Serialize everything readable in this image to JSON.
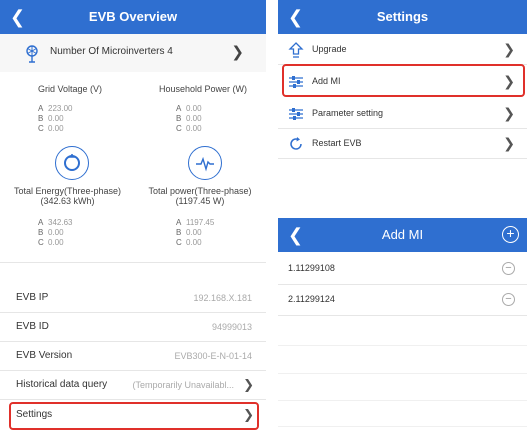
{
  "left": {
    "title": "EVB Overview",
    "microinverters_label": "Number Of Microinverters 4",
    "grid_voltage": {
      "title": "Grid Voltage  (V)",
      "phases": [
        {
          "k": "A",
          "v": "223.00"
        },
        {
          "k": "B",
          "v": "0.00"
        },
        {
          "k": "C",
          "v": "0.00"
        }
      ]
    },
    "household_power": {
      "title": "Household Power  (W)",
      "phases": [
        {
          "k": "A",
          "v": "0.00"
        },
        {
          "k": "B",
          "v": "0.00"
        },
        {
          "k": "C",
          "v": "0.00"
        }
      ]
    },
    "total_energy": {
      "title": "Total Energy(Three-phase)",
      "subtitle": "(342.63 kWh)",
      "phases": [
        {
          "k": "A",
          "v": "342.63"
        },
        {
          "k": "B",
          "v": "0.00"
        },
        {
          "k": "C",
          "v": "0.00"
        }
      ]
    },
    "total_power": {
      "title": "Total power(Three-phase)",
      "subtitle": "(1197.45 W)",
      "phases": [
        {
          "k": "A",
          "v": "1197.45"
        },
        {
          "k": "B",
          "v": "0.00"
        },
        {
          "k": "C",
          "v": "0.00"
        }
      ]
    },
    "info_rows": [
      {
        "label": "EVB IP",
        "value": "192.168.X.181"
      },
      {
        "label": "EVB ID",
        "value": "94999013"
      },
      {
        "label": "EVB Version",
        "value": "EVB300-E-N-01-14"
      }
    ],
    "historical": {
      "label": "Historical data query",
      "value": "(Temporarily Unavailabl..."
    },
    "settings_label": "Settings"
  },
  "settings": {
    "title": "Settings",
    "items": [
      {
        "label": "Upgrade"
      },
      {
        "label": "Add MI"
      },
      {
        "label": "Parameter setting"
      },
      {
        "label": "Restart EVB"
      }
    ]
  },
  "addmi": {
    "title": "Add MI",
    "items": [
      {
        "label": "1.11299108"
      },
      {
        "label": "2.11299124"
      }
    ]
  },
  "colors": {
    "header": "#2f6fd0",
    "highlight": "#e0302a"
  }
}
